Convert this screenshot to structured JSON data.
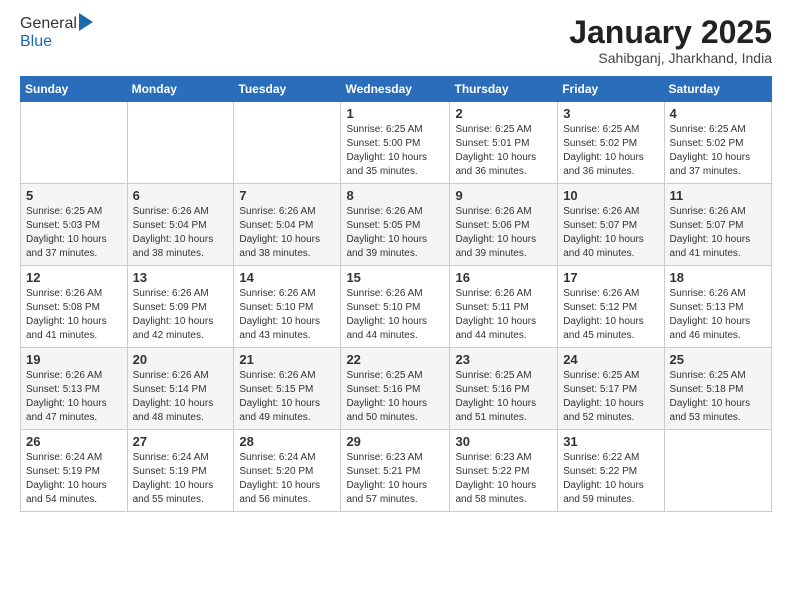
{
  "header": {
    "logo_general": "General",
    "logo_blue": "Blue",
    "title": "January 2025",
    "subtitle": "Sahibganj, Jharkhand, India"
  },
  "weekdays": [
    "Sunday",
    "Monday",
    "Tuesday",
    "Wednesday",
    "Thursday",
    "Friday",
    "Saturday"
  ],
  "weeks": [
    [
      {
        "day": "",
        "info": ""
      },
      {
        "day": "",
        "info": ""
      },
      {
        "day": "",
        "info": ""
      },
      {
        "day": "1",
        "info": "Sunrise: 6:25 AM\nSunset: 5:00 PM\nDaylight: 10 hours\nand 35 minutes."
      },
      {
        "day": "2",
        "info": "Sunrise: 6:25 AM\nSunset: 5:01 PM\nDaylight: 10 hours\nand 36 minutes."
      },
      {
        "day": "3",
        "info": "Sunrise: 6:25 AM\nSunset: 5:02 PM\nDaylight: 10 hours\nand 36 minutes."
      },
      {
        "day": "4",
        "info": "Sunrise: 6:25 AM\nSunset: 5:02 PM\nDaylight: 10 hours\nand 37 minutes."
      }
    ],
    [
      {
        "day": "5",
        "info": "Sunrise: 6:25 AM\nSunset: 5:03 PM\nDaylight: 10 hours\nand 37 minutes."
      },
      {
        "day": "6",
        "info": "Sunrise: 6:26 AM\nSunset: 5:04 PM\nDaylight: 10 hours\nand 38 minutes."
      },
      {
        "day": "7",
        "info": "Sunrise: 6:26 AM\nSunset: 5:04 PM\nDaylight: 10 hours\nand 38 minutes."
      },
      {
        "day": "8",
        "info": "Sunrise: 6:26 AM\nSunset: 5:05 PM\nDaylight: 10 hours\nand 39 minutes."
      },
      {
        "day": "9",
        "info": "Sunrise: 6:26 AM\nSunset: 5:06 PM\nDaylight: 10 hours\nand 39 minutes."
      },
      {
        "day": "10",
        "info": "Sunrise: 6:26 AM\nSunset: 5:07 PM\nDaylight: 10 hours\nand 40 minutes."
      },
      {
        "day": "11",
        "info": "Sunrise: 6:26 AM\nSunset: 5:07 PM\nDaylight: 10 hours\nand 41 minutes."
      }
    ],
    [
      {
        "day": "12",
        "info": "Sunrise: 6:26 AM\nSunset: 5:08 PM\nDaylight: 10 hours\nand 41 minutes."
      },
      {
        "day": "13",
        "info": "Sunrise: 6:26 AM\nSunset: 5:09 PM\nDaylight: 10 hours\nand 42 minutes."
      },
      {
        "day": "14",
        "info": "Sunrise: 6:26 AM\nSunset: 5:10 PM\nDaylight: 10 hours\nand 43 minutes."
      },
      {
        "day": "15",
        "info": "Sunrise: 6:26 AM\nSunset: 5:10 PM\nDaylight: 10 hours\nand 44 minutes."
      },
      {
        "day": "16",
        "info": "Sunrise: 6:26 AM\nSunset: 5:11 PM\nDaylight: 10 hours\nand 44 minutes."
      },
      {
        "day": "17",
        "info": "Sunrise: 6:26 AM\nSunset: 5:12 PM\nDaylight: 10 hours\nand 45 minutes."
      },
      {
        "day": "18",
        "info": "Sunrise: 6:26 AM\nSunset: 5:13 PM\nDaylight: 10 hours\nand 46 minutes."
      }
    ],
    [
      {
        "day": "19",
        "info": "Sunrise: 6:26 AM\nSunset: 5:13 PM\nDaylight: 10 hours\nand 47 minutes."
      },
      {
        "day": "20",
        "info": "Sunrise: 6:26 AM\nSunset: 5:14 PM\nDaylight: 10 hours\nand 48 minutes."
      },
      {
        "day": "21",
        "info": "Sunrise: 6:26 AM\nSunset: 5:15 PM\nDaylight: 10 hours\nand 49 minutes."
      },
      {
        "day": "22",
        "info": "Sunrise: 6:25 AM\nSunset: 5:16 PM\nDaylight: 10 hours\nand 50 minutes."
      },
      {
        "day": "23",
        "info": "Sunrise: 6:25 AM\nSunset: 5:16 PM\nDaylight: 10 hours\nand 51 minutes."
      },
      {
        "day": "24",
        "info": "Sunrise: 6:25 AM\nSunset: 5:17 PM\nDaylight: 10 hours\nand 52 minutes."
      },
      {
        "day": "25",
        "info": "Sunrise: 6:25 AM\nSunset: 5:18 PM\nDaylight: 10 hours\nand 53 minutes."
      }
    ],
    [
      {
        "day": "26",
        "info": "Sunrise: 6:24 AM\nSunset: 5:19 PM\nDaylight: 10 hours\nand 54 minutes."
      },
      {
        "day": "27",
        "info": "Sunrise: 6:24 AM\nSunset: 5:19 PM\nDaylight: 10 hours\nand 55 minutes."
      },
      {
        "day": "28",
        "info": "Sunrise: 6:24 AM\nSunset: 5:20 PM\nDaylight: 10 hours\nand 56 minutes."
      },
      {
        "day": "29",
        "info": "Sunrise: 6:23 AM\nSunset: 5:21 PM\nDaylight: 10 hours\nand 57 minutes."
      },
      {
        "day": "30",
        "info": "Sunrise: 6:23 AM\nSunset: 5:22 PM\nDaylight: 10 hours\nand 58 minutes."
      },
      {
        "day": "31",
        "info": "Sunrise: 6:22 AM\nSunset: 5:22 PM\nDaylight: 10 hours\nand 59 minutes."
      },
      {
        "day": "",
        "info": ""
      }
    ]
  ]
}
